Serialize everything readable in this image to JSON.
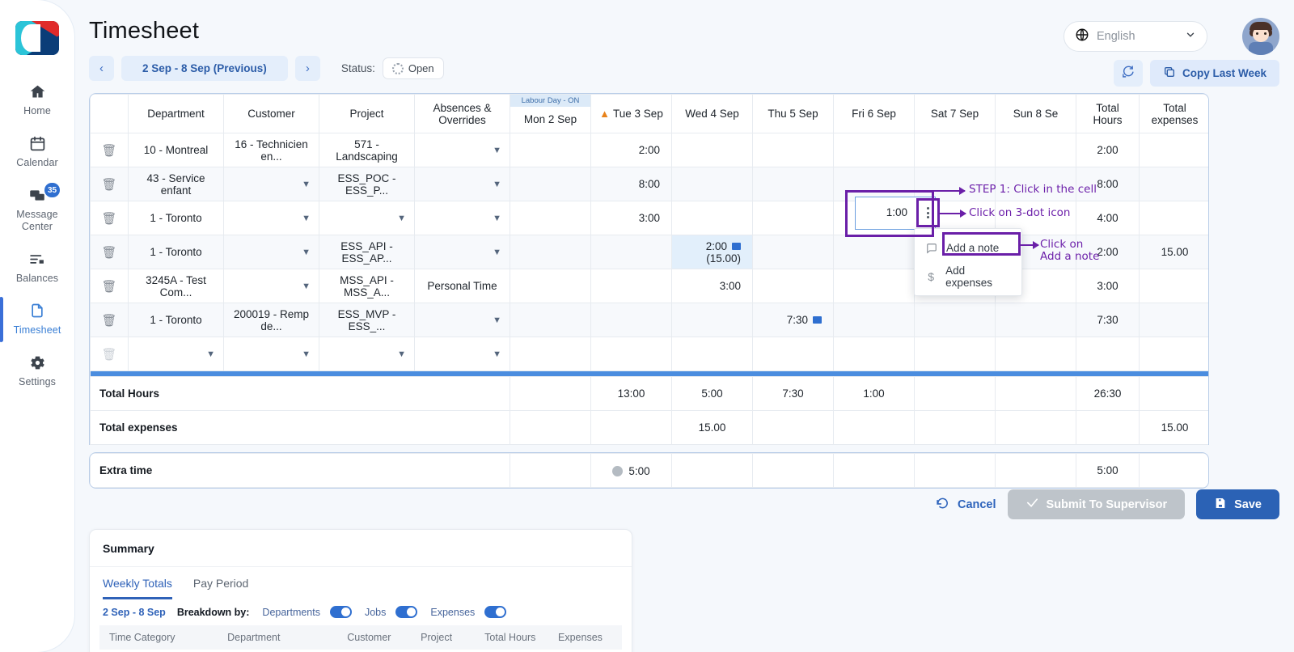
{
  "sidebar": {
    "logo_name": "company-logo",
    "items": [
      {
        "label": "Home",
        "icon": "home-icon",
        "active": false
      },
      {
        "label": "Calendar",
        "icon": "calendar-icon",
        "active": false
      },
      {
        "label": "Message\nCenter",
        "icon": "message-icon",
        "active": false,
        "badge": "35"
      },
      {
        "label": "Balances",
        "icon": "balances-icon",
        "active": false
      },
      {
        "label": "Timesheet",
        "icon": "document-icon",
        "active": true
      },
      {
        "label": "Settings",
        "icon": "gear-icon",
        "active": false
      }
    ]
  },
  "header": {
    "title": "Timesheet",
    "language": "English",
    "language_icon": "globe-icon",
    "avatar": "user-avatar",
    "prev_label": "‹",
    "next_label": "›",
    "period": "2 Sep - 8 Sep (Previous)",
    "status_label": "Status:",
    "status_value": "Open",
    "refresh_icon": "refresh-icon",
    "copy_last_week": "Copy Last Week",
    "copy_icon": "copy-icon"
  },
  "grid": {
    "columns": [
      "",
      "Department",
      "Customer",
      "Project",
      "Absences & Overrides",
      "Mon 2 Sep",
      "Tue 3 Sep",
      "Wed 4 Sep",
      "Thu 5 Sep",
      "Fri 6 Sep",
      "Sat 7 Sep",
      "Sun 8 Se",
      "Total Hours",
      "Total expenses"
    ],
    "holiday_banner": "Labour Day - ON",
    "holiday_column": "Mon 2 Sep",
    "warning_column": "Tue 3 Sep",
    "rows": [
      {
        "department": "10 - Montreal",
        "customer": "16 - Technicien en...",
        "project": "571 - Landscaping",
        "absence": "",
        "mon": "",
        "tue": "2:00",
        "wed": "",
        "thu": "",
        "fri": "",
        "sat": "",
        "sun": "",
        "total_hours": "2:00",
        "total_expenses": ""
      },
      {
        "department": "43 - Service enfant",
        "customer": "",
        "project": "ESS_POC - ESS_P...",
        "absence": "",
        "mon": "",
        "tue": "8:00",
        "wed": "",
        "thu": "",
        "fri": "",
        "sat": "",
        "sun": "",
        "total_hours": "8:00",
        "total_expenses": ""
      },
      {
        "department": "1 - Toronto",
        "customer": "",
        "project": "",
        "absence": "",
        "mon": "",
        "tue": "3:00",
        "wed": "",
        "thu": "",
        "fri": "1:00",
        "sat": "",
        "sun": "",
        "total_hours": "4:00",
        "total_expenses": ""
      },
      {
        "department": "1 - Toronto",
        "customer": "",
        "project": "ESS_API - ESS_AP...",
        "absence": "",
        "mon": "",
        "tue": "",
        "wed": "2:00",
        "wed_expense": "(15.00)",
        "thu": "",
        "fri": "",
        "sat": "",
        "sun": "",
        "total_hours": "2:00",
        "total_expenses": "15.00"
      },
      {
        "department": "3245A - Test Com...",
        "customer": "",
        "project": "MSS_API - MSS_A...",
        "absence": "Personal Time",
        "mon": "",
        "tue": "",
        "wed": "3:00",
        "thu": "",
        "fri": "",
        "sat": "",
        "sun": "",
        "total_hours": "3:00",
        "total_expenses": ""
      },
      {
        "department": "1 - Toronto",
        "customer": "200019 - Remp de...",
        "project": "ESS_MVP - ESS_...",
        "absence": "",
        "mon": "",
        "tue": "",
        "wed": "",
        "thu": "7:30",
        "fri": "",
        "sat": "",
        "sun": "",
        "total_hours": "7:30",
        "total_expenses": ""
      },
      {
        "department": "",
        "customer": "",
        "project": "",
        "absence": "",
        "mon": "",
        "tue": "",
        "wed": "",
        "thu": "",
        "fri": "",
        "sat": "",
        "sun": "",
        "total_hours": "",
        "total_expenses": ""
      }
    ],
    "totals": {
      "hours_label": "Total Hours",
      "hours": {
        "mon": "",
        "tue": "13:00",
        "wed": "5:00",
        "thu": "7:30",
        "fri": "1:00",
        "sat": "",
        "sun": "",
        "total": "26:30",
        "expenses": ""
      },
      "expenses_label": "Total expenses",
      "expenses": {
        "mon": "",
        "tue": "",
        "wed": "15.00",
        "thu": "",
        "fri": "",
        "sat": "",
        "sun": "",
        "total": "",
        "expenses": "15.00"
      }
    },
    "extra": {
      "label": "Extra time",
      "values": {
        "mon": "",
        "tue": "5:00",
        "wed": "",
        "thu": "",
        "fri": "",
        "sat": "",
        "sun": "",
        "total": "5:00",
        "expenses": ""
      }
    }
  },
  "selected_cell": {
    "value": "1:00",
    "day": "Fri 6 Sep"
  },
  "context_menu": {
    "items": [
      {
        "label": "Add a note",
        "icon": "note-icon"
      },
      {
        "label": "Add expenses",
        "icon": "dollar-icon"
      }
    ]
  },
  "annotations": [
    {
      "text": "STEP 1: Click in the cell"
    },
    {
      "text": "Click on 3-dot icon"
    },
    {
      "text": "Click on\nAdd a note"
    }
  ],
  "actions": {
    "cancel": "Cancel",
    "cancel_icon": "undo-icon",
    "submit": "Submit To Supervisor",
    "submit_icon": "check-icon",
    "save": "Save",
    "save_icon": "save-icon"
  },
  "summary": {
    "title": "Summary",
    "tabs": [
      {
        "label": "Weekly Totals",
        "active": true
      },
      {
        "label": "Pay Period",
        "active": false
      }
    ],
    "range": "2 Sep - 8 Sep",
    "breakdown_label": "Breakdown by:",
    "toggles": [
      {
        "label": "Departments",
        "on": true
      },
      {
        "label": "Jobs",
        "on": true
      },
      {
        "label": "Expenses",
        "on": true
      }
    ],
    "table_columns": [
      "Time Category",
      "Department",
      "Customer",
      "Project",
      "Total Hours",
      "Expenses"
    ]
  },
  "colors": {
    "accent_blue": "#2f62b8",
    "light_blue": "#e4eefb",
    "annotation_purple": "#6a1fa8",
    "warning_orange": "#e8821a",
    "separator_blue": "#4b8ddf"
  }
}
